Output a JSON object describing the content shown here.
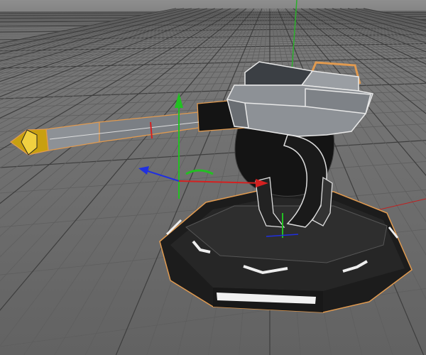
{
  "viewport": {
    "mode": "perspective",
    "colors": {
      "sky": "#8c8c8c",
      "floor": "#6a6a6a",
      "grid_minor": "#5e5e5e",
      "grid_major": "#3e3e3e",
      "axis_x": "#d42020",
      "axis_y": "#22c022",
      "axis_z": "#2030e0",
      "selection_outline": "#e09a50",
      "model_dark": "#1e1e1e",
      "model_grey": "#8d9196",
      "wire": "#e8e8e8",
      "tip": "#d8b020"
    }
  },
  "icons": [
    "move-gizmo-icon",
    "world-axis-icon"
  ]
}
